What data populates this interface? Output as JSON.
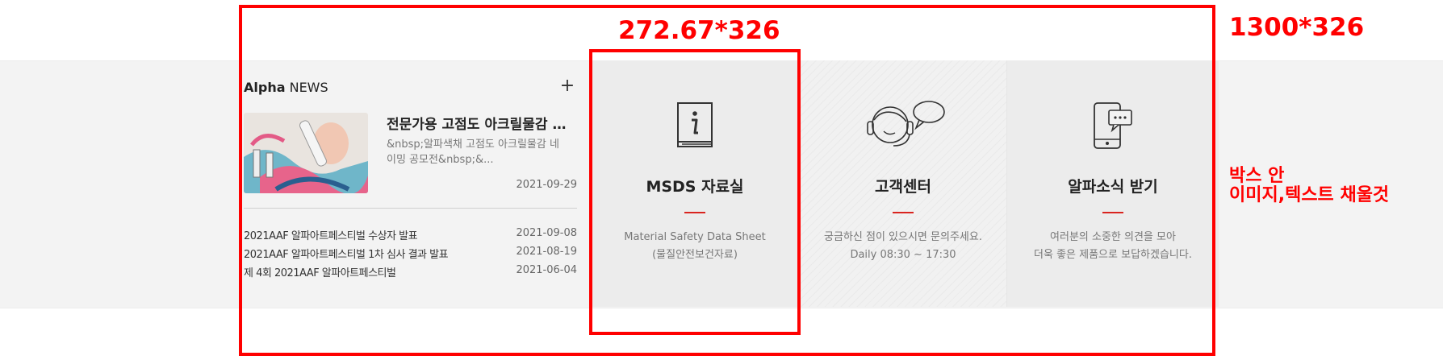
{
  "news": {
    "title_bold": "Alpha",
    "title_rest": " NEWS",
    "more_label": "+",
    "featured": {
      "headline": "전문가용 고점도 아크릴물감 알파색채",
      "description": "&nbsp;알파색채 고점도 아크릴물감 네이밍 공모전&nbsp;&...",
      "date": "2021-09-29"
    },
    "items": [
      {
        "title": "2021AAF 알파아트페스티벌 수상자 발표",
        "date": "2021-09-08"
      },
      {
        "title": "2021AAF 알파아트페스티벌 1차 심사 결과 발표",
        "date": "2021-08-19"
      },
      {
        "title": "제 4회 2021AAF 알파아트페스티벌",
        "date": "2021-06-04"
      }
    ]
  },
  "boxes": {
    "msds": {
      "title": "MSDS 자료실",
      "desc_line1": "Material Safety Data Sheet",
      "desc_line2": "(물질안전보건자료)",
      "icon": "info-book-icon"
    },
    "customer_center": {
      "title": "고객센터",
      "desc_line1": "궁금하신 점이 있으시면 문의주세요.",
      "desc_line2": "Daily 08:30 ~ 17:30",
      "icon": "headset-chat-icon"
    },
    "alpha_news_receive": {
      "title": "알파소식 받기",
      "desc_line1": "여러분의 소중한 의견을 모아",
      "desc_line2": "더욱 좋은 제품으로 보답하겠습니다.",
      "icon": "mobile-chat-icon"
    }
  },
  "annotations": {
    "inner_size": "272.67*326",
    "outer_size": "1300*326",
    "note_line1": "박스 안",
    "note_line2": "이미지,텍스트 채울것"
  },
  "colors": {
    "accent": "#d9241f",
    "annotation": "#ff0000",
    "band_bg": "#f3f3f3"
  }
}
